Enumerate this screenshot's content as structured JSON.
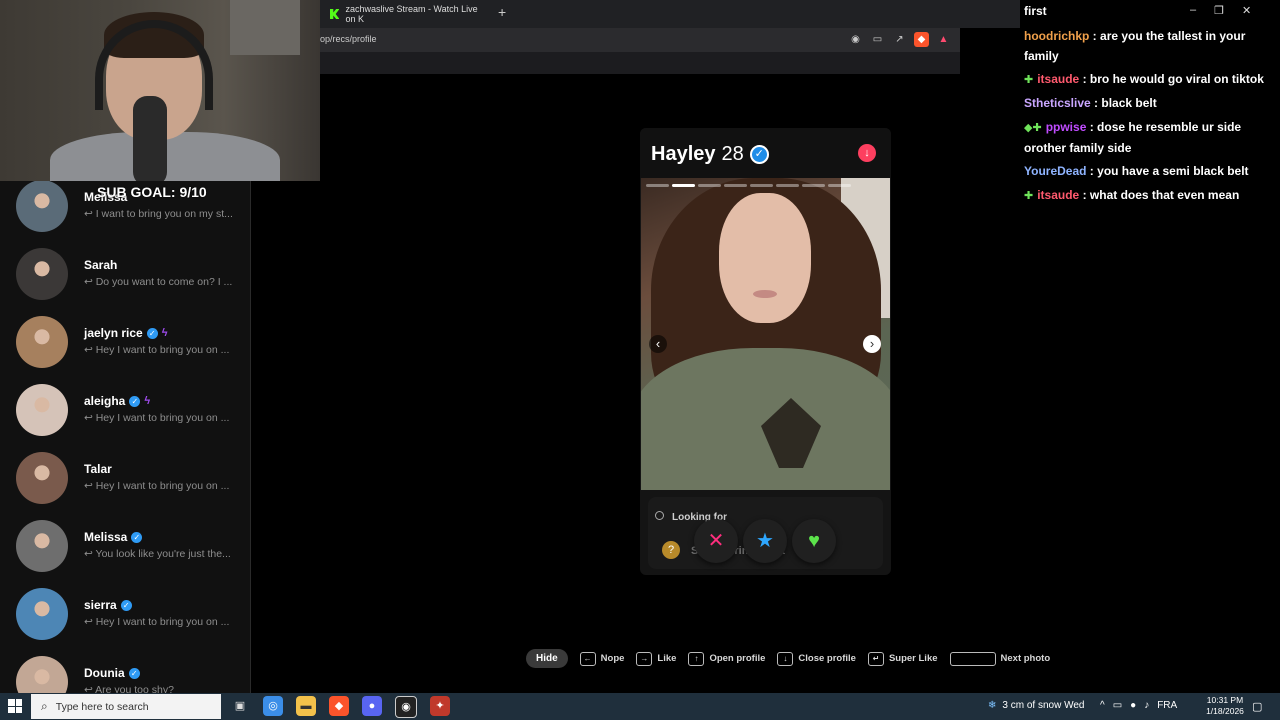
{
  "browser": {
    "tab_title": "zachwaslive Stream - Watch Live on K",
    "new_tab": "+",
    "url": "op/recs/profile",
    "window_controls": [
      "–",
      "❐",
      "✕"
    ]
  },
  "stream_overlay": {
    "sub_goal": "SUB GOAL: 9/10"
  },
  "sidebar": {
    "conversations": [
      {
        "name": "Melissa",
        "message": "I want to bring you on my st...",
        "verified": false,
        "bolt": false,
        "avatar_color": "#5a6b78"
      },
      {
        "name": "Sarah",
        "message": "Do you want to come on? I ...",
        "verified": false,
        "bolt": false,
        "avatar_color": "#3b3837"
      },
      {
        "name": "jaelyn rice",
        "message": "Hey I want to bring you on ...",
        "verified": true,
        "bolt": true,
        "avatar_color": "#a6805e"
      },
      {
        "name": "aleigha",
        "message": "Hey I want to bring you on ...",
        "verified": true,
        "bolt": true,
        "avatar_color": "#d5c3b8"
      },
      {
        "name": "Talar",
        "message": "Hey I want to bring you on ...",
        "verified": false,
        "bolt": false,
        "avatar_color": "#7a5a4c"
      },
      {
        "name": "Melissa",
        "message": "You look like you're just the...",
        "verified": true,
        "bolt": false,
        "avatar_color": "#6e6e6e"
      },
      {
        "name": "sierra",
        "message": "Hey I want to bring you on ...",
        "verified": true,
        "bolt": false,
        "avatar_color": "#4d86b5"
      },
      {
        "name": "Dounia",
        "message": "Are you too shy?",
        "verified": true,
        "bolt": false,
        "avatar_color": "#c2a795"
      }
    ]
  },
  "profile": {
    "name": "Hayley",
    "age": "28",
    "photo_count": 8,
    "active_photo": 2,
    "looking_for_label": "Looking for",
    "looking_for_value": "Still figuring it out"
  },
  "actions": {
    "nope_icon": "✕",
    "superlike_icon": "★",
    "like_icon": "♥"
  },
  "hints": {
    "hide": "Hide",
    "nope": "Nope",
    "like": "Like",
    "open_profile": "Open profile",
    "close_profile": "Close profile",
    "super_like": "Super Like",
    "next_photo": "Next photo"
  },
  "chat": {
    "title": "first",
    "messages": [
      {
        "user": "hoodrichkp",
        "text": "are you the tallest in your family",
        "color": "#f0a04b",
        "badge": ""
      },
      {
        "user": "itsaude",
        "text": "bro he would go viral on tiktok",
        "color": "#ff5a6e",
        "badge": "✚"
      },
      {
        "user": "Stheticslive",
        "text": "black belt",
        "color": "#c9a6ff",
        "badge": ""
      },
      {
        "user": "ppwise",
        "text": "dose he resemble ur side orother family side",
        "color": "#c04cff",
        "badge": "◆✚"
      },
      {
        "user": "YoureDead",
        "text": "you have a semi black belt",
        "color": "#8fb4ff",
        "badge": ""
      },
      {
        "user": "itsaude",
        "text": "what does that even mean",
        "color": "#ff5a6e",
        "badge": "✚"
      }
    ]
  },
  "taskbar": {
    "search_placeholder": "Type here to search",
    "weather": "3 cm of snow Wed",
    "language": "FRA",
    "time": "10:31 PM",
    "date": "1/18/2026"
  }
}
